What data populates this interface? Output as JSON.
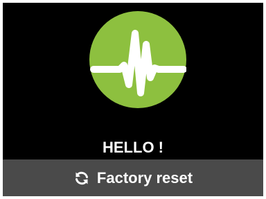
{
  "screen": {
    "logo": {
      "icon": "heartbeat-wave-icon",
      "circle_color": "#8dc03f",
      "wave_color": "#ffffff"
    },
    "greeting": "HELLO !",
    "reset_button": {
      "icon": "refresh-icon",
      "label": "Factory reset",
      "background": "#4a4a4a"
    }
  }
}
